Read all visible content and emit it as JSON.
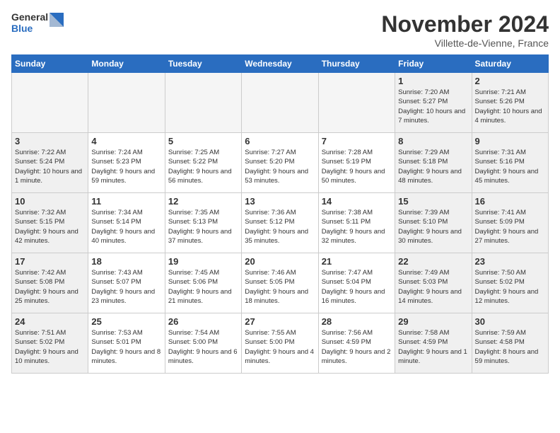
{
  "logo": {
    "general": "General",
    "blue": "Blue"
  },
  "header": {
    "month": "November 2024",
    "location": "Villette-de-Vienne, France"
  },
  "weekdays": [
    "Sunday",
    "Monday",
    "Tuesday",
    "Wednesday",
    "Thursday",
    "Friday",
    "Saturday"
  ],
  "weeks": [
    [
      {
        "day": "",
        "info": "",
        "empty": true
      },
      {
        "day": "",
        "info": "",
        "empty": true
      },
      {
        "day": "",
        "info": "",
        "empty": true
      },
      {
        "day": "",
        "info": "",
        "empty": true
      },
      {
        "day": "",
        "info": "",
        "empty": true
      },
      {
        "day": "1",
        "info": "Sunrise: 7:20 AM\nSunset: 5:27 PM\nDaylight: 10 hours and 7 minutes.",
        "weekend": true
      },
      {
        "day": "2",
        "info": "Sunrise: 7:21 AM\nSunset: 5:26 PM\nDaylight: 10 hours and 4 minutes.",
        "weekend": true
      }
    ],
    [
      {
        "day": "3",
        "info": "Sunrise: 7:22 AM\nSunset: 5:24 PM\nDaylight: 10 hours and 1 minute.",
        "weekend": true
      },
      {
        "day": "4",
        "info": "Sunrise: 7:24 AM\nSunset: 5:23 PM\nDaylight: 9 hours and 59 minutes."
      },
      {
        "day": "5",
        "info": "Sunrise: 7:25 AM\nSunset: 5:22 PM\nDaylight: 9 hours and 56 minutes."
      },
      {
        "day": "6",
        "info": "Sunrise: 7:27 AM\nSunset: 5:20 PM\nDaylight: 9 hours and 53 minutes."
      },
      {
        "day": "7",
        "info": "Sunrise: 7:28 AM\nSunset: 5:19 PM\nDaylight: 9 hours and 50 minutes."
      },
      {
        "day": "8",
        "info": "Sunrise: 7:29 AM\nSunset: 5:18 PM\nDaylight: 9 hours and 48 minutes.",
        "weekend": true
      },
      {
        "day": "9",
        "info": "Sunrise: 7:31 AM\nSunset: 5:16 PM\nDaylight: 9 hours and 45 minutes.",
        "weekend": true
      }
    ],
    [
      {
        "day": "10",
        "info": "Sunrise: 7:32 AM\nSunset: 5:15 PM\nDaylight: 9 hours and 42 minutes.",
        "weekend": true
      },
      {
        "day": "11",
        "info": "Sunrise: 7:34 AM\nSunset: 5:14 PM\nDaylight: 9 hours and 40 minutes."
      },
      {
        "day": "12",
        "info": "Sunrise: 7:35 AM\nSunset: 5:13 PM\nDaylight: 9 hours and 37 minutes."
      },
      {
        "day": "13",
        "info": "Sunrise: 7:36 AM\nSunset: 5:12 PM\nDaylight: 9 hours and 35 minutes."
      },
      {
        "day": "14",
        "info": "Sunrise: 7:38 AM\nSunset: 5:11 PM\nDaylight: 9 hours and 32 minutes."
      },
      {
        "day": "15",
        "info": "Sunrise: 7:39 AM\nSunset: 5:10 PM\nDaylight: 9 hours and 30 minutes.",
        "weekend": true
      },
      {
        "day": "16",
        "info": "Sunrise: 7:41 AM\nSunset: 5:09 PM\nDaylight: 9 hours and 27 minutes.",
        "weekend": true
      }
    ],
    [
      {
        "day": "17",
        "info": "Sunrise: 7:42 AM\nSunset: 5:08 PM\nDaylight: 9 hours and 25 minutes.",
        "weekend": true
      },
      {
        "day": "18",
        "info": "Sunrise: 7:43 AM\nSunset: 5:07 PM\nDaylight: 9 hours and 23 minutes."
      },
      {
        "day": "19",
        "info": "Sunrise: 7:45 AM\nSunset: 5:06 PM\nDaylight: 9 hours and 21 minutes."
      },
      {
        "day": "20",
        "info": "Sunrise: 7:46 AM\nSunset: 5:05 PM\nDaylight: 9 hours and 18 minutes."
      },
      {
        "day": "21",
        "info": "Sunrise: 7:47 AM\nSunset: 5:04 PM\nDaylight: 9 hours and 16 minutes."
      },
      {
        "day": "22",
        "info": "Sunrise: 7:49 AM\nSunset: 5:03 PM\nDaylight: 9 hours and 14 minutes.",
        "weekend": true
      },
      {
        "day": "23",
        "info": "Sunrise: 7:50 AM\nSunset: 5:02 PM\nDaylight: 9 hours and 12 minutes.",
        "weekend": true
      }
    ],
    [
      {
        "day": "24",
        "info": "Sunrise: 7:51 AM\nSunset: 5:02 PM\nDaylight: 9 hours and 10 minutes.",
        "weekend": true
      },
      {
        "day": "25",
        "info": "Sunrise: 7:53 AM\nSunset: 5:01 PM\nDaylight: 9 hours and 8 minutes."
      },
      {
        "day": "26",
        "info": "Sunrise: 7:54 AM\nSunset: 5:00 PM\nDaylight: 9 hours and 6 minutes."
      },
      {
        "day": "27",
        "info": "Sunrise: 7:55 AM\nSunset: 5:00 PM\nDaylight: 9 hours and 4 minutes."
      },
      {
        "day": "28",
        "info": "Sunrise: 7:56 AM\nSunset: 4:59 PM\nDaylight: 9 hours and 2 minutes."
      },
      {
        "day": "29",
        "info": "Sunrise: 7:58 AM\nSunset: 4:59 PM\nDaylight: 9 hours and 1 minute.",
        "weekend": true
      },
      {
        "day": "30",
        "info": "Sunrise: 7:59 AM\nSunset: 4:58 PM\nDaylight: 8 hours and 59 minutes.",
        "weekend": true
      }
    ]
  ]
}
